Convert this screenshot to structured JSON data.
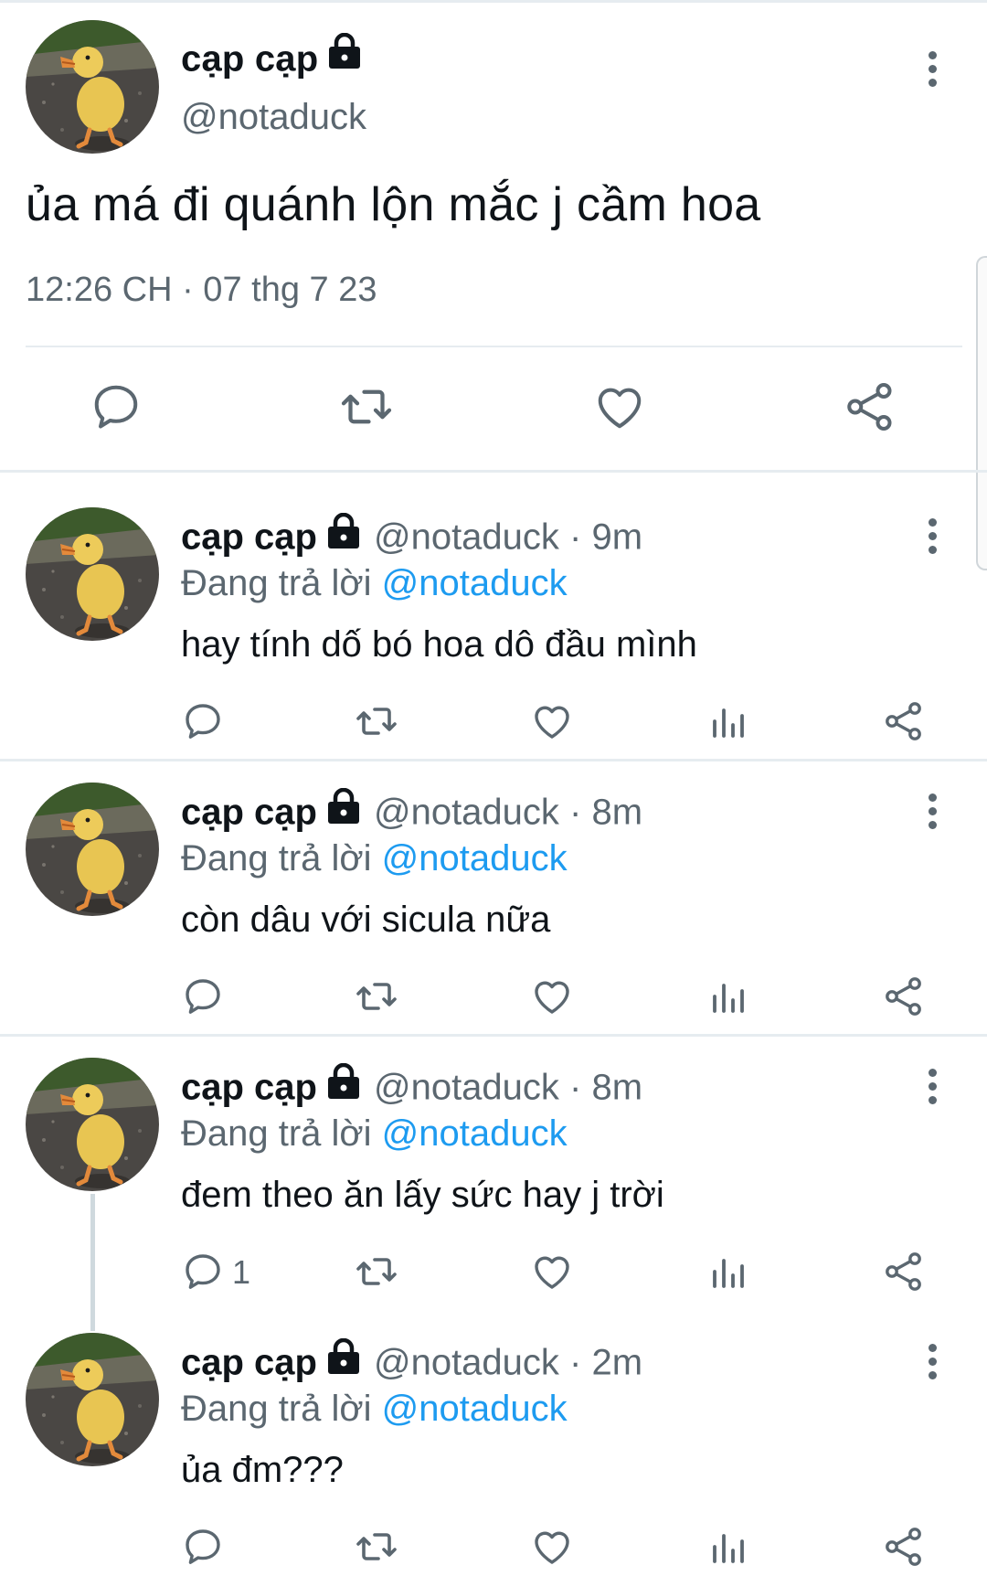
{
  "colors": {
    "text": "#0f1419",
    "secondary": "#5b6770",
    "link": "#1d9bf0",
    "divider": "#e6ecf0"
  },
  "main_tweet": {
    "display_name": "cạp cạp",
    "handle": "@notaduck",
    "text": "ủa má đi quánh lộn mắc j cầm hoa",
    "timestamp": "12:26 CH · 07 thg 7 23",
    "actions": [
      "reply-icon",
      "retweet-icon",
      "like-icon",
      "share-icon"
    ]
  },
  "replies": [
    {
      "display_name": "cạp cạp",
      "handle": "@notaduck",
      "separator": "·",
      "time": "9m",
      "replying_prefix": "Đang trả lời",
      "replying_to": "@notaduck",
      "text": "hay tính dố bó hoa dô đầu mình",
      "reply_count": ""
    },
    {
      "display_name": "cạp cạp",
      "handle": "@notaduck",
      "separator": "·",
      "time": "8m",
      "replying_prefix": "Đang trả lời",
      "replying_to": "@notaduck",
      "text": "còn dâu với sicula nữa",
      "reply_count": ""
    },
    {
      "display_name": "cạp cạp",
      "handle": "@notaduck",
      "separator": "·",
      "time": "8m",
      "replying_prefix": "Đang trả lời",
      "replying_to": "@notaduck",
      "text": "đem theo ăn lấy sức hay j trời",
      "reply_count": "1"
    },
    {
      "display_name": "cạp cạp",
      "handle": "@notaduck",
      "separator": "·",
      "time": "2m",
      "replying_prefix": "Đang trả lời",
      "replying_to": "@notaduck",
      "text": "ủa đm???",
      "reply_count": ""
    }
  ]
}
